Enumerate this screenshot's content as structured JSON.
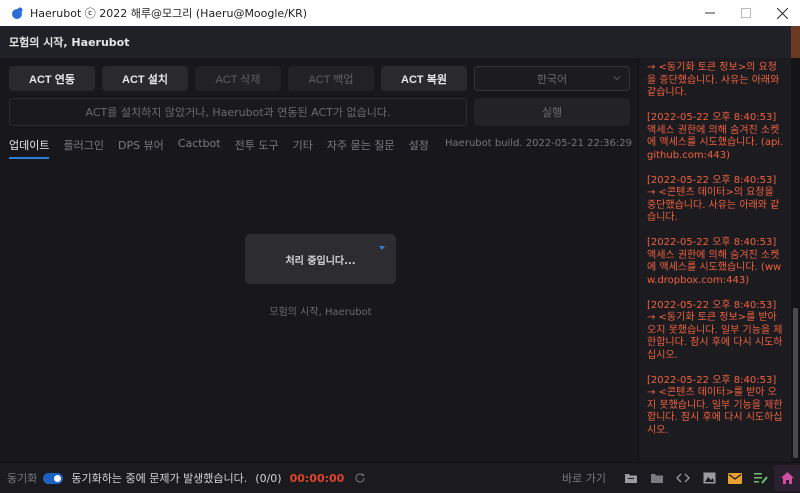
{
  "window": {
    "title": "Haerubot ⓒ 2022 해루@모그리 (Haeru@Moogle/KR)",
    "controls": [
      "minimize",
      "maximize",
      "close"
    ]
  },
  "header": {
    "title": "모험의 시작, Haerubot"
  },
  "toolbar": {
    "buttons": [
      {
        "label": "ACT 연동",
        "enabled": true
      },
      {
        "label": "ACT 설치",
        "enabled": true
      },
      {
        "label": "ACT 삭제",
        "enabled": false
      },
      {
        "label": "ACT 백업",
        "enabled": false
      },
      {
        "label": "ACT 복원",
        "enabled": true
      }
    ],
    "language": "한국어",
    "notice": "ACT를 설치하지 않았거나, Haerubot과 연동된 ACT가 없습니다.",
    "run_label": "실행"
  },
  "tabs": [
    {
      "label": "업데이트",
      "active": true
    },
    {
      "label": "플러그인",
      "active": false
    },
    {
      "label": "DPS 뷰어",
      "active": false
    },
    {
      "label": "Cactbot",
      "active": false
    },
    {
      "label": "전투 도구",
      "active": false
    },
    {
      "label": "기타",
      "active": false
    },
    {
      "label": "자주 묻는 질문",
      "active": false
    },
    {
      "label": "설정",
      "active": false
    }
  ],
  "build": "Haerubot build. 2022-05-21 22:36:29",
  "progress": {
    "message": "처리 중입니다...",
    "footer": "모험의 시작, Haerubot"
  },
  "log": [
    "→ <동기화 토큰 정보>의 요청을 중단했습니다. 사유는 아래와 같습니다.",
    "[2022-05-22 오후 8:40:53] 액세스 권한에 의해 숨겨진 소켓에 액세스를 시도했습니다. (api.github.com:443)",
    "[2022-05-22 오후 8:40:53] → <콘텐츠 데이터>의 요청을 중단했습니다. 사유는 아래와 같습니다.",
    "[2022-05-22 오후 8:40:53] 액세스 권한에 의해 숨겨진 소켓에 액세스를 시도했습니다. (www.dropbox.com:443)",
    "[2022-05-22 오후 8:40:53] → <동기화 토큰 정보>를 받아오지 못했습니다. 일부 기능을 제한합니다. 잠시 후에 다시 시도하십시오.",
    "[2022-05-22 오후 8:40:53] → <콘텐츠 데이터>를 받아 오지 못했습니다. 일부 기능을 제한합니다. 잠시 후에 다시 시도하십시오."
  ],
  "statusbar": {
    "sync_label": "동기화",
    "sync_on": true,
    "message": "동기화하는 중에 문제가 발생했습니다.",
    "count": "(0/0)",
    "timer": "00:00:00",
    "goto_label": "바로 가기",
    "shortcuts": [
      {
        "icon": "folder-open-icon",
        "color": "#9a9aa0"
      },
      {
        "icon": "folder-icon",
        "color": "#7a7a80"
      },
      {
        "icon": "code-icon",
        "color": "#9a9aa0"
      },
      {
        "icon": "image-icon",
        "color": "#9a9aa0"
      },
      {
        "icon": "mail-icon",
        "color": "#e8a030"
      },
      {
        "icon": "edit-list-icon",
        "color": "#6cc070"
      },
      {
        "icon": "home-icon",
        "color": "#d04fa0"
      }
    ]
  },
  "colors": {
    "accent": "#2a7fd8",
    "log_text": "#f2623f",
    "timer": "#e04428"
  }
}
